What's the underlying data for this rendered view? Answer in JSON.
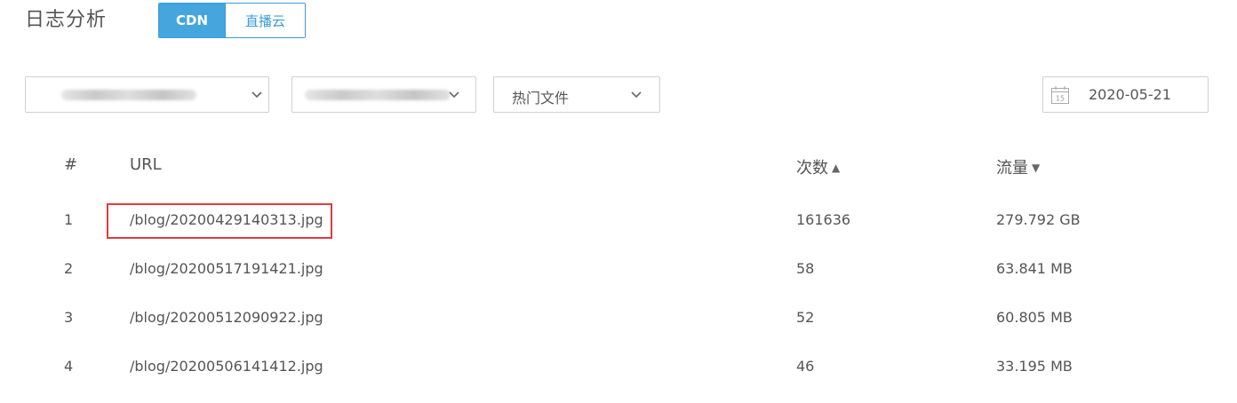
{
  "header": {
    "title": "日志分析",
    "tabs": [
      {
        "label": "CDN",
        "active": true
      },
      {
        "label": "直播云",
        "active": false
      }
    ]
  },
  "filters": {
    "domain_select": {
      "value": "",
      "blurred": true
    },
    "host_select": {
      "value": "",
      "blurred": true
    },
    "type_select": {
      "value": "热门文件"
    },
    "date": {
      "value": "2020-05-21",
      "icon": "calendar-icon",
      "icon_day": "15"
    }
  },
  "table": {
    "columns": {
      "index": "#",
      "url": "URL",
      "count": "次数",
      "count_sort": "▲",
      "traffic": "流量",
      "traffic_sort": "▼"
    },
    "rows": [
      {
        "index": "1",
        "url": "/blog/20200429140313.jpg",
        "count": "161636",
        "traffic": "279.792 GB",
        "highlighted": true
      },
      {
        "index": "2",
        "url": "/blog/20200517191421.jpg",
        "count": "58",
        "traffic": "63.841 MB"
      },
      {
        "index": "3",
        "url": "/blog/20200512090922.jpg",
        "count": "52",
        "traffic": "60.805 MB"
      },
      {
        "index": "4",
        "url": "/blog/20200506141412.jpg",
        "count": "46",
        "traffic": "33.195 MB"
      }
    ]
  },
  "colors": {
    "accent": "#44a6dd",
    "highlight_border": "#e23b3b"
  }
}
